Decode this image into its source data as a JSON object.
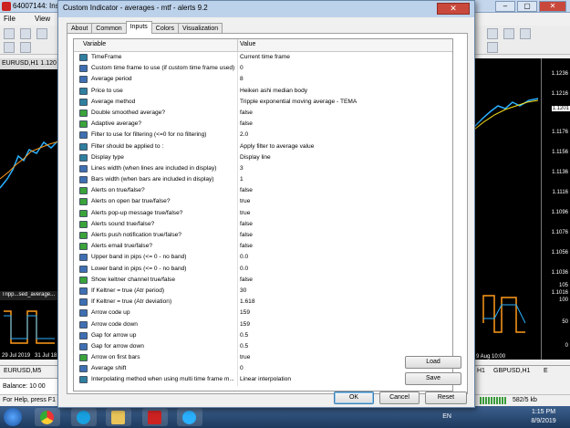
{
  "mt4": {
    "window_title": "64007144: Insta",
    "menu": [
      "File",
      "View"
    ],
    "chart_left_title": "EURUSD,H1  1.120",
    "indicator_title": "Tripp...sed_average...",
    "dates": [
      "29 Jul 2019",
      "31 Jul 18"
    ],
    "chart_tabs": [
      "EURUSD,M5",
      "H1",
      "GBPUSD,H1",
      "E"
    ],
    "right_dates": [
      "9 Aug 10:00"
    ],
    "price_labels": [
      "1.1236",
      "1.1216",
      "1.1201",
      "1.1176",
      "1.1156",
      "1.1136",
      "1.1116",
      "1.1096",
      "1.1076",
      "1.1056",
      "1.1036",
      "1.1016",
      "105",
      "100",
      "50",
      "0"
    ],
    "current_price": "1.1201",
    "balance": "Balance: 10 00",
    "status_help": "For Help, press F1",
    "traffic": "582/5 kb"
  },
  "taskbar": {
    "lang": "EN",
    "time": "1:15 PM",
    "date": "8/9/2019"
  },
  "dialog": {
    "title": "Custom Indicator - averages - mtf - alerts  9.2",
    "close_label": "✕",
    "tabs": [
      "About",
      "Common",
      "Inputs",
      "Colors",
      "Visualization"
    ],
    "active_tab": "Inputs",
    "col_variable": "Variable",
    "col_value": "Value",
    "rows": [
      {
        "type": "enum",
        "label": "TimeFrame",
        "value": "Current time frame"
      },
      {
        "type": "num",
        "label": "Custom time frame to use (if custom time frame used)",
        "value": "0"
      },
      {
        "type": "num",
        "label": "Average period",
        "value": "8"
      },
      {
        "type": "enum",
        "label": "Price to use",
        "value": "Heiken ashi median body"
      },
      {
        "type": "enum",
        "label": "Average method",
        "value": "Tripple exponential moving average - TEMA"
      },
      {
        "type": "bool",
        "label": "Double smoothed average?",
        "value": "false"
      },
      {
        "type": "bool",
        "label": "Adaptive average?",
        "value": "false"
      },
      {
        "type": "num",
        "label": "Filter to use for filtering (<=0 for no filtering)",
        "value": "2.0"
      },
      {
        "type": "enum",
        "label": "Filter should be applied to :",
        "value": "Apply filter to average value"
      },
      {
        "type": "enum",
        "label": "Display type",
        "value": "Display line"
      },
      {
        "type": "num",
        "label": "Lines width (when lines are included in display)",
        "value": "3"
      },
      {
        "type": "num",
        "label": "Bars width (when bars are included in display)",
        "value": "1"
      },
      {
        "type": "bool",
        "label": "Alerts on true/false?",
        "value": "false"
      },
      {
        "type": "bool",
        "label": "Alerts on open bar true/false?",
        "value": "true"
      },
      {
        "type": "bool",
        "label": "Alerts pop-up message true/false?",
        "value": "true"
      },
      {
        "type": "bool",
        "label": "Alerts sound true/false?",
        "value": "false"
      },
      {
        "type": "bool",
        "label": "Alerts push notification true/false?",
        "value": "false"
      },
      {
        "type": "bool",
        "label": "Alerts email true/false?",
        "value": "false"
      },
      {
        "type": "num",
        "label": "Upper band in pips (<= 0 - no band)",
        "value": "0.0"
      },
      {
        "type": "num",
        "label": "Lower band in pips (<= 0 - no band)",
        "value": "0.0"
      },
      {
        "type": "bool",
        "label": "Show keltner channel true/false",
        "value": "false"
      },
      {
        "type": "num",
        "label": "If Keltner = true (Atr period)",
        "value": "30"
      },
      {
        "type": "num",
        "label": "If Keltner = true (Atr deviation)",
        "value": "1.618"
      },
      {
        "type": "num",
        "label": "Arrow code up",
        "value": "159"
      },
      {
        "type": "num",
        "label": "Arrow code down",
        "value": "159"
      },
      {
        "type": "num",
        "label": "Gap for arrow up",
        "value": "0.5"
      },
      {
        "type": "num",
        "label": "Gap for arrow down",
        "value": "0.5"
      },
      {
        "type": "bool",
        "label": "Arrow on first bars",
        "value": "true"
      },
      {
        "type": "num",
        "label": "Average shift",
        "value": "0"
      },
      {
        "type": "enum",
        "label": "Interpolating method when using multi time frame m...",
        "value": "Linear interpolation"
      }
    ],
    "load_label": "Load",
    "save_label": "Save",
    "ok_label": "OK",
    "cancel_label": "Cancel",
    "reset_label": "Reset"
  }
}
